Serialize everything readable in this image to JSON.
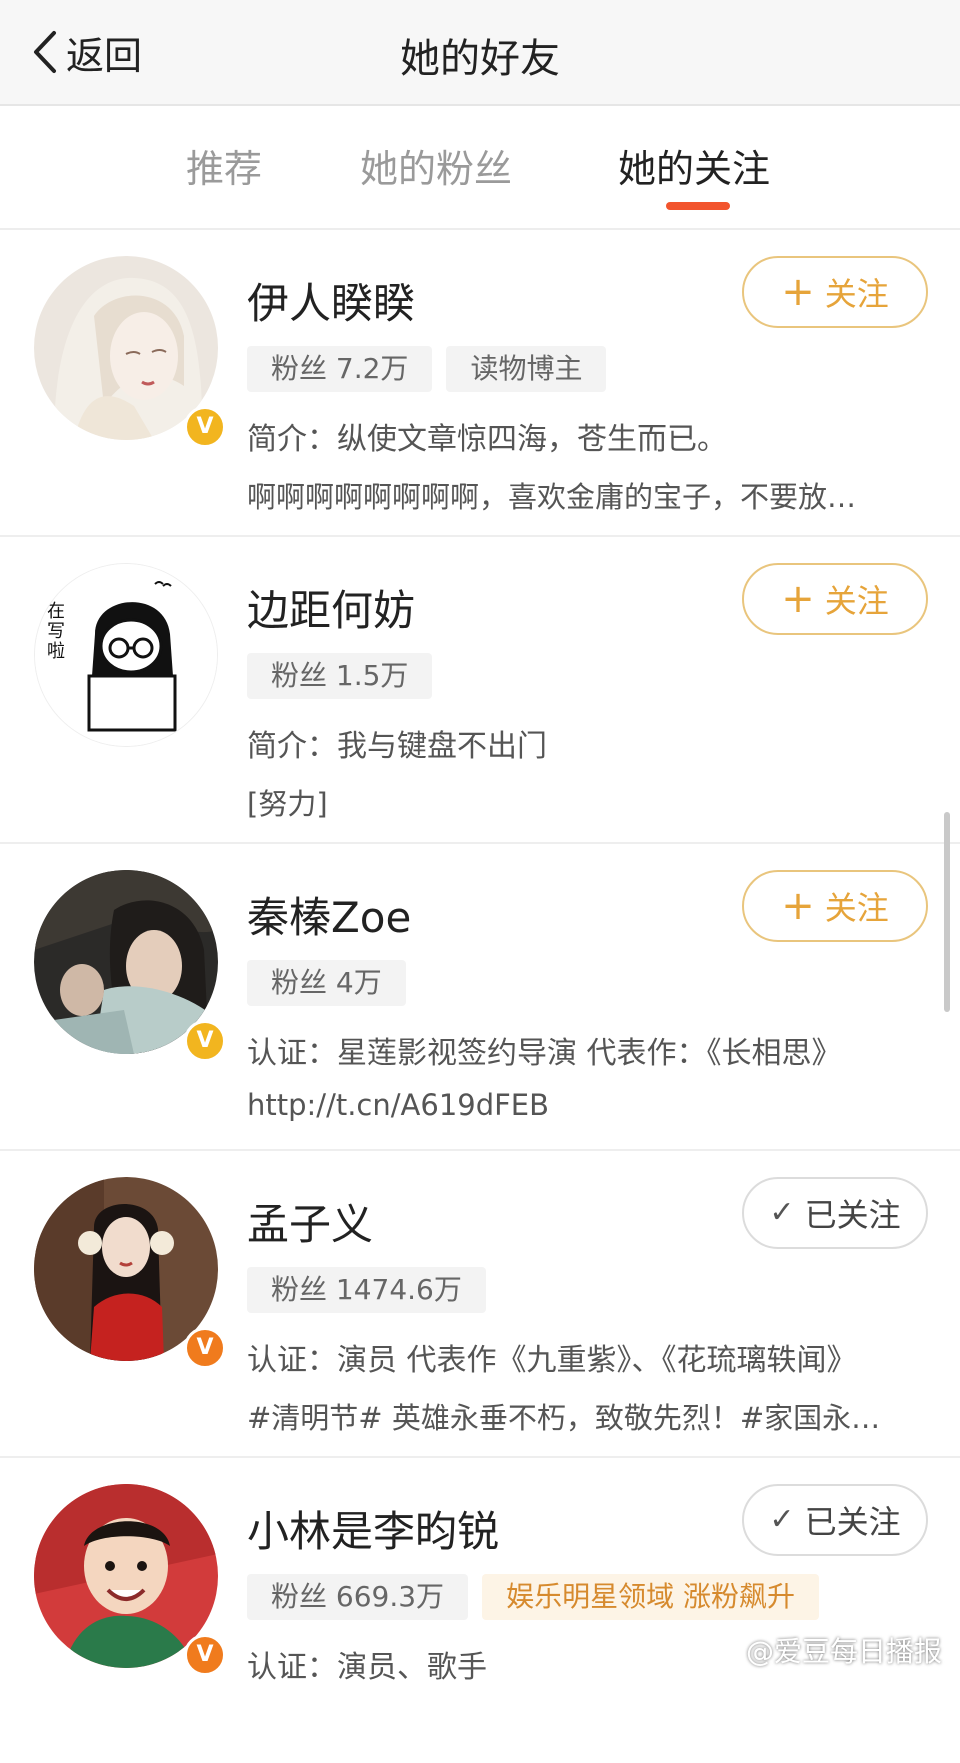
{
  "nav": {
    "back_label": "返回",
    "title": "她的好友"
  },
  "tabs": [
    {
      "label": "推荐",
      "active": false
    },
    {
      "label": "她的粉丝",
      "active": false
    },
    {
      "label": "她的关注",
      "active": true
    }
  ],
  "accent_color": "#f2542d",
  "follow_color": "#e6a43a",
  "users": [
    {
      "name": "伊人睽睽",
      "tags": [
        "粉丝 7.2万",
        "读物博主"
      ],
      "desc": "简介：纵使文章惊四海，苍生而已。",
      "desc2": "啊啊啊啊啊啊啊啊，喜欢金庸的宝子，不要放…",
      "button": {
        "icon": "+",
        "label": "关注",
        "state": "follow"
      },
      "verified": "gold",
      "badge_letter": "V"
    },
    {
      "name": "边距何妨",
      "tags": [
        "粉丝 1.5万"
      ],
      "desc": "简介：我与键盘不出门",
      "desc2": "[努力]",
      "button": {
        "icon": "+",
        "label": "关注",
        "state": "follow"
      },
      "verified": "none",
      "avatar_text": "在写啦"
    },
    {
      "name": "秦榛Zoe",
      "tags": [
        "粉丝 4万"
      ],
      "desc": "认证：星莲影视签约导演 代表作：《长相思》",
      "desc2": "http://t.cn/A619dFEB",
      "button": {
        "icon": "+",
        "label": "关注",
        "state": "follow"
      },
      "verified": "gold",
      "badge_letter": "V"
    },
    {
      "name": "孟子义",
      "tags": [
        "粉丝 1474.6万"
      ],
      "desc": "认证：演员 代表作《九重紫》、《花琉璃轶闻》",
      "desc2": "#清明节# 英雄永垂不朽，致敬先烈！#家国永…",
      "button": {
        "icon": "✓",
        "label": "已关注",
        "state": "followed"
      },
      "verified": "orange",
      "badge_letter": "V"
    },
    {
      "name": "小林是李昀锐",
      "tags": [
        "粉丝 669.3万",
        "娱乐明星领域 涨粉飙升"
      ],
      "desc": "认证：演员、歌手",
      "desc2": "",
      "button": {
        "icon": "✓",
        "label": "已关注",
        "state": "followed"
      },
      "verified": "orange",
      "badge_letter": "V"
    }
  ],
  "watermark": {
    "text": "@爱豆每日播报",
    "icon": "weibo-icon"
  }
}
